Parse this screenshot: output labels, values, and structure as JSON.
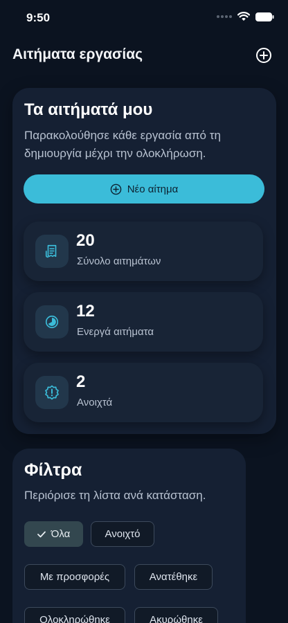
{
  "status_bar": {
    "time": "9:50"
  },
  "header": {
    "title": "Αιτήματα εργασίας",
    "add_icon": "plus-circle-icon"
  },
  "overview": {
    "title": "Τα αιτήματά μου",
    "subtitle": "Παρακολούθησε κάθε εργασία από τη δημιουργία μέχρι την ολοκλήρωση.",
    "new_request_label": "Νέο αίτημα",
    "stats": [
      {
        "value": "20",
        "label": "Σύνολο αιτημάτων",
        "icon": "receipt-icon"
      },
      {
        "value": "12",
        "label": "Ενεργά αιτήματα",
        "icon": "progress-clock-icon"
      },
      {
        "value": "2",
        "label": "Ανοιχτά",
        "icon": "alert-badge-icon"
      }
    ]
  },
  "filters": {
    "title": "Φίλτρα",
    "subtitle": "Περιόρισε τη λίστα ανά κατάσταση.",
    "chips": [
      {
        "label": "Όλα",
        "selected": true
      },
      {
        "label": "Ανοιχτό",
        "selected": false
      },
      {
        "label": "Με προσφορές",
        "selected": false
      },
      {
        "label": "Ανατέθηκε",
        "selected": false
      },
      {
        "label": "Ολοκληρώθηκε",
        "selected": false
      },
      {
        "label": "Ακυρώθηκε",
        "selected": false
      }
    ]
  },
  "colors": {
    "background": "#0b1320",
    "card": "#152033",
    "accent": "#3bbcd9",
    "muted_text": "#b8c2d1"
  }
}
